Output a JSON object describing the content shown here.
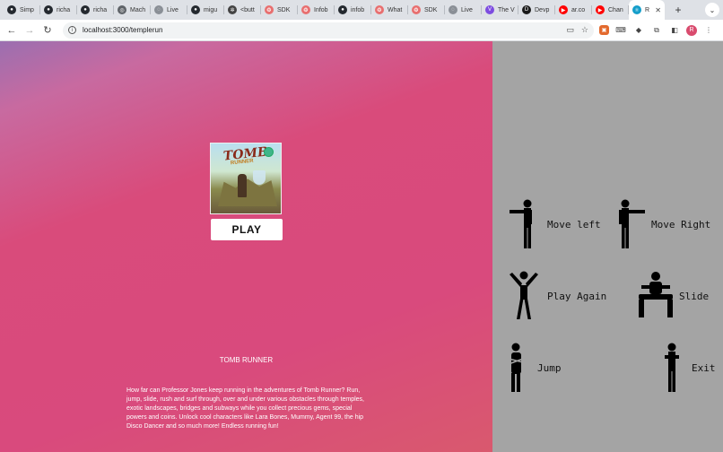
{
  "browser": {
    "tabs": [
      {
        "label": "Simp",
        "icon": "github-icon",
        "color": "#24292f"
      },
      {
        "label": "richa",
        "icon": "github-icon",
        "color": "#24292f"
      },
      {
        "label": "richa",
        "icon": "github-icon",
        "color": "#24292f"
      },
      {
        "label": "Mach",
        "icon": "globe-icon",
        "color": "#5f6368"
      },
      {
        "label": "Live",
        "icon": "loading-icon",
        "color": "#8a8f96"
      },
      {
        "label": "migu",
        "icon": "github-icon",
        "color": "#24292f"
      },
      {
        "label": "<butt",
        "icon": "gear-icon",
        "color": "#444444"
      },
      {
        "label": "SDK",
        "icon": "sdk-icon",
        "color": "#e86f6f"
      },
      {
        "label": "Infob",
        "icon": "sdk-icon",
        "color": "#e86f6f"
      },
      {
        "label": "infob",
        "icon": "github-icon",
        "color": "#24292f"
      },
      {
        "label": "What",
        "icon": "sdk-icon",
        "color": "#e86f6f"
      },
      {
        "label": "SDK",
        "icon": "sdk-icon",
        "color": "#e86f6f"
      },
      {
        "label": "Live",
        "icon": "loading-icon",
        "color": "#8a8f96"
      },
      {
        "label": "The V",
        "icon": "vite-icon",
        "color": "#7d4ce0"
      },
      {
        "label": "Devp",
        "icon": "devpost-icon",
        "color": "#1a1a1a"
      },
      {
        "label": "ar.co",
        "icon": "youtube-icon",
        "color": "#ff0000"
      },
      {
        "label": "Chan",
        "icon": "youtube-icon",
        "color": "#ff0000"
      },
      {
        "label": "R",
        "icon": "react-icon",
        "color": "#149eca",
        "active": true
      }
    ],
    "new_tab_label": "+",
    "close_glyph": "✕",
    "url": "localhost:3000/templerun",
    "profile_initial": "R"
  },
  "game": {
    "cover_logo_line1": "TOMB",
    "cover_logo_line2": "RUNNER",
    "play_label": "PLAY",
    "title": "TOMB RUNNER",
    "description": "How far can Professor Jones keep running in the adventures of Tomb Runner? Run, jump, slide, rush and surf through, over and under various obstacles through temples, exotic landscapes, bridges and subways while you collect precious gems, special powers and coins. Unlock cool characters like Lara Bones, Mummy, Agent 99, the hip Disco Dancer and so much more! Endless running fun!"
  },
  "controls": {
    "move_left": "Move left",
    "move_right": "Move Right",
    "play_again": "Play Again",
    "slide": "Slide",
    "jump": "Jump",
    "exit": "Exit"
  },
  "colors": {
    "game_bg_accent": "#d94b7b",
    "controls_bg": "#a4a4a4"
  }
}
